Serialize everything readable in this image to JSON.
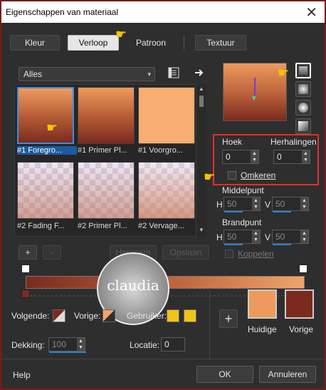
{
  "window": {
    "title": "Eigenschappen van materiaal",
    "close_glyph": "✕"
  },
  "tabs": [
    {
      "label": "Kleur",
      "active": false
    },
    {
      "label": "Verloop",
      "active": true
    },
    {
      "label": "Patroon",
      "active": false
    },
    {
      "label": "Textuur",
      "active": false
    }
  ],
  "category_select": {
    "value": "Alles",
    "arrow": "▾"
  },
  "toolbar_icons": {
    "library": "library-icon",
    "next": "arrow-right-icon"
  },
  "gradients": [
    {
      "label": "#1 Foregro...",
      "selected": true,
      "style": "grad-vert-a"
    },
    {
      "label": "#1 Primer Pl...",
      "selected": false,
      "style": "grad-vert-a"
    },
    {
      "label": "#1 Voorgro...",
      "selected": false,
      "style": "grad-light"
    },
    {
      "label": "#2 Fading F...",
      "selected": false,
      "style": "checker"
    },
    {
      "label": "#2 Primer Pl...",
      "selected": false,
      "style": "checker"
    },
    {
      "label": "#2 Vervage...",
      "selected": false,
      "style": "checker-b"
    }
  ],
  "list_buttons": {
    "add": "+",
    "remove": "-",
    "rename": "Hernoem",
    "save": "Opslaan"
  },
  "params": {
    "hoek_label": "Hoek",
    "hoek_value": "0",
    "herhalingen_label": "Herhalingen",
    "herhalingen_value": "0",
    "omkeren_label": "Omkeren",
    "omkeren_checked": false,
    "middelpunt_label": "Middelpunt",
    "mid_h_label": "H",
    "mid_h_value": "50",
    "mid_v_label": "V",
    "mid_v_value": "50",
    "brandpunt_label": "Brandpunt",
    "br_h_label": "H",
    "br_h_value": "50",
    "br_v_label": "V",
    "br_v_value": "50",
    "koppelen_label": "Koppelen",
    "koppelen_checked": false
  },
  "gradient_stops": {
    "volgende_label": "Volgende:",
    "vorige_label": "Vorige:",
    "gebruiker_label": "Gebruiker:",
    "dekking_label": "Dekking:",
    "dekking_value": "100",
    "locatie_label": "Locatie:",
    "locatie_value": "0",
    "user_color": "#f2c318",
    "left_color": "#7b2a1e",
    "right_color": "#f0a46a"
  },
  "swatches": {
    "add_glyph": "+",
    "huidige_label": "Huidige",
    "huidige_color": "#ee9a5e",
    "vorige_label": "Vorige",
    "vorige_color": "#7b2a1e"
  },
  "watermark": {
    "text": "claudia"
  },
  "footer": {
    "help": "Help",
    "ok": "OK",
    "cancel": "Annuleren"
  }
}
